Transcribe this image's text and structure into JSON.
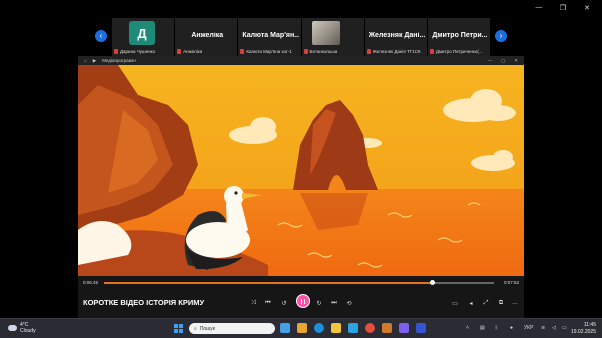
{
  "participants": [
    {
      "name": "",
      "sub": "Дарина Чушенко",
      "avatar_letter": "Д"
    },
    {
      "name": "Анжеліка",
      "sub": "Анжеліка"
    },
    {
      "name": "Калюта Мар'ян...",
      "sub": "Калюта Мар'яна хог-1"
    },
    {
      "name": "",
      "sub": "Бетанкольша"
    },
    {
      "name": "Железняк Дані...",
      "sub": "Железняк Данія ТГ1СК"
    },
    {
      "name": "Дмитро Петри...",
      "sub": "Дмитро Петриченко(..."
    }
  ],
  "player": {
    "window_title": "Медіапрогравач",
    "video_title": "КОРОТКЕ ВІДЕО ІСТОРІЯ КРИМУ",
    "time_elapsed": "0:06:45",
    "time_total": "0:07:52",
    "progress": 0.84
  },
  "taskbar": {
    "weather_temp": "4°C",
    "weather_cond": "Cloudy",
    "search_placeholder": "Пошук",
    "lang": "УКР",
    "time": "11:45",
    "date": "19.02.2025"
  },
  "colors": {
    "accent_blue": "#1d6fe0",
    "play_button": "#ff4fa8",
    "progress_fill": "#e86f1b",
    "sky": "#f2a21c",
    "sea": "#f07a12"
  }
}
